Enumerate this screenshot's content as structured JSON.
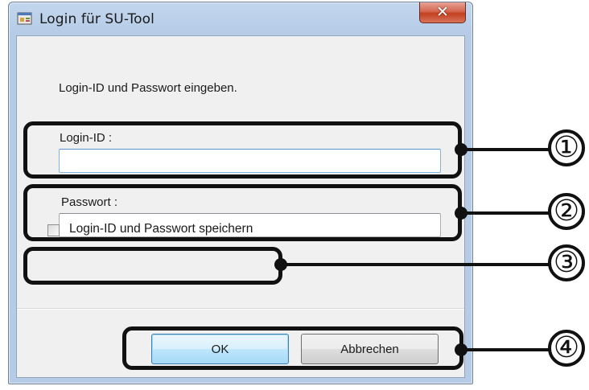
{
  "window": {
    "title": "Login für SU-Tool",
    "close_glyph": "✕",
    "app_icon": "app-icon"
  },
  "dialog": {
    "instruction": "Login-ID und Passwort eingeben.",
    "login_label": "Login-ID :",
    "login_value": "",
    "password_label": "Passwort :",
    "password_value": "",
    "remember_label": "Login-ID und Passwort speichern",
    "remember_checked": false,
    "ok_label": "OK",
    "cancel_label": "Abbrechen"
  },
  "callouts": [
    "①",
    "②",
    "③",
    "④"
  ],
  "colors": {
    "annotation": "#111111",
    "close_button": "#c2401f",
    "focus_border": "#7eb4ea"
  }
}
